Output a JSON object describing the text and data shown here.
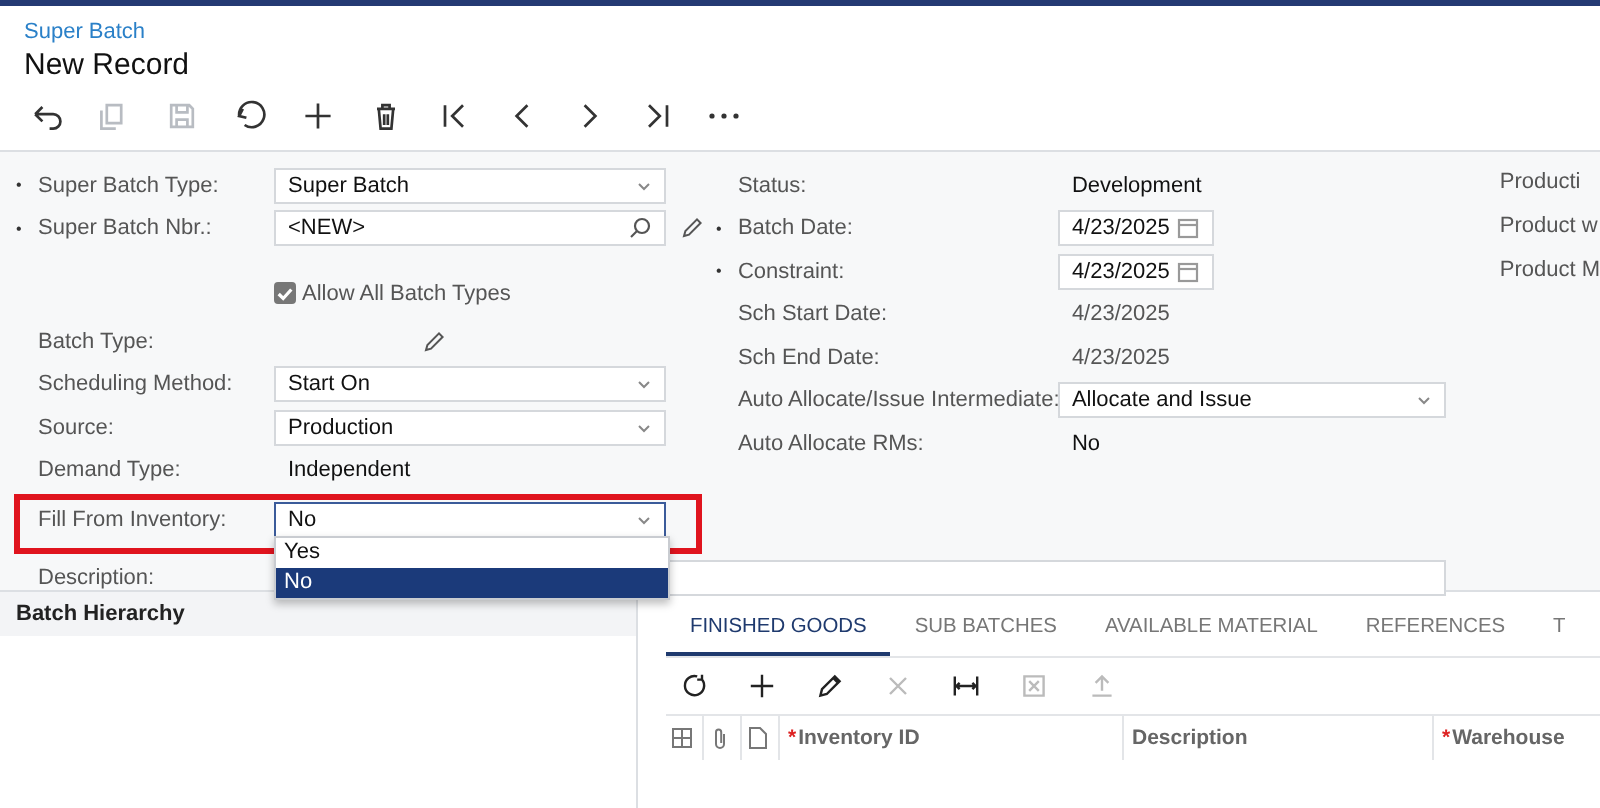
{
  "breadcrumb": "Super Batch",
  "title": "New Record",
  "toolbar": [
    {
      "disabled": false
    },
    {
      "disabled": true
    },
    {
      "disabled": true
    },
    {
      "disabled": false
    },
    {
      "disabled": false
    },
    {
      "disabled": false
    },
    {
      "disabled": false
    },
    {
      "disabled": false
    },
    {
      "disabled": false
    },
    {
      "disabled": false
    },
    {
      "disabled": false
    }
  ],
  "left_fields": [
    {
      "kind": "select",
      "mark": "•",
      "label": "Super Batch Type:",
      "value": "Super Batch"
    },
    {
      "kind": "lookup",
      "mark": "•",
      "label": "Super Batch Nbr.:",
      "value": "<NEW>",
      "edit_icon": true
    },
    {
      "kind": "checkbox",
      "label": "Allow All Batch Types",
      "checked": true
    },
    {
      "kind": "empty",
      "label": "Batch Type:",
      "edit_icon": true
    },
    {
      "kind": "select",
      "label": "Scheduling Method:",
      "value": "Start On"
    },
    {
      "kind": "select",
      "label": "Source:",
      "value": "Production"
    },
    {
      "kind": "text",
      "label": "Demand Type:",
      "value": "Independent"
    },
    {
      "kind": "select",
      "label": "Fill From Inventory:",
      "value": "No",
      "highlighted": true,
      "open": true,
      "options": [
        {
          "label": "Yes",
          "selected": false
        },
        {
          "label": "No",
          "selected": true
        }
      ]
    }
  ],
  "right_fields": [
    {
      "kind": "text",
      "label": "Status:",
      "value": "Development"
    },
    {
      "kind": "date",
      "mark": "•",
      "label": "Batch Date:",
      "value": "4/23/2025"
    },
    {
      "kind": "date",
      "mark": "•",
      "label": "Constraint:",
      "value": "4/23/2025"
    },
    {
      "kind": "readonly",
      "label": "Sch Start Date:",
      "value": "4/23/2025"
    },
    {
      "kind": "readonly",
      "label": "Sch End Date:",
      "value": "4/23/2025"
    },
    {
      "kind": "select",
      "label": "Auto Allocate/Issue Intermediate:",
      "value": "Allocate and Issue"
    },
    {
      "kind": "text",
      "label": "Auto Allocate RMs:",
      "value": "No"
    }
  ],
  "far_right_labels": [
    "Producti",
    "Product w",
    "Product M"
  ],
  "description": {
    "label": "Description:"
  },
  "hierarchy": {
    "title": "Batch Hierarchy"
  },
  "tabs": [
    {
      "label": "FINISHED GOODS",
      "selected": true
    },
    {
      "label": "SUB BATCHES",
      "selected": false
    },
    {
      "label": "AVAILABLE MATERIAL",
      "selected": false
    },
    {
      "label": "REFERENCES",
      "selected": false
    },
    {
      "label": "T",
      "selected": false
    }
  ],
  "grid_toolbar": [
    {
      "disabled": false
    },
    {
      "disabled": false
    },
    {
      "disabled": false
    },
    {
      "disabled": true
    },
    {
      "disabled": false
    },
    {
      "disabled": true
    },
    {
      "disabled": true
    }
  ],
  "grid_columns": [
    {
      "mark": "*",
      "label": "Inventory ID"
    },
    {
      "label": "Description"
    },
    {
      "mark": "*",
      "label": "Warehouse"
    }
  ]
}
